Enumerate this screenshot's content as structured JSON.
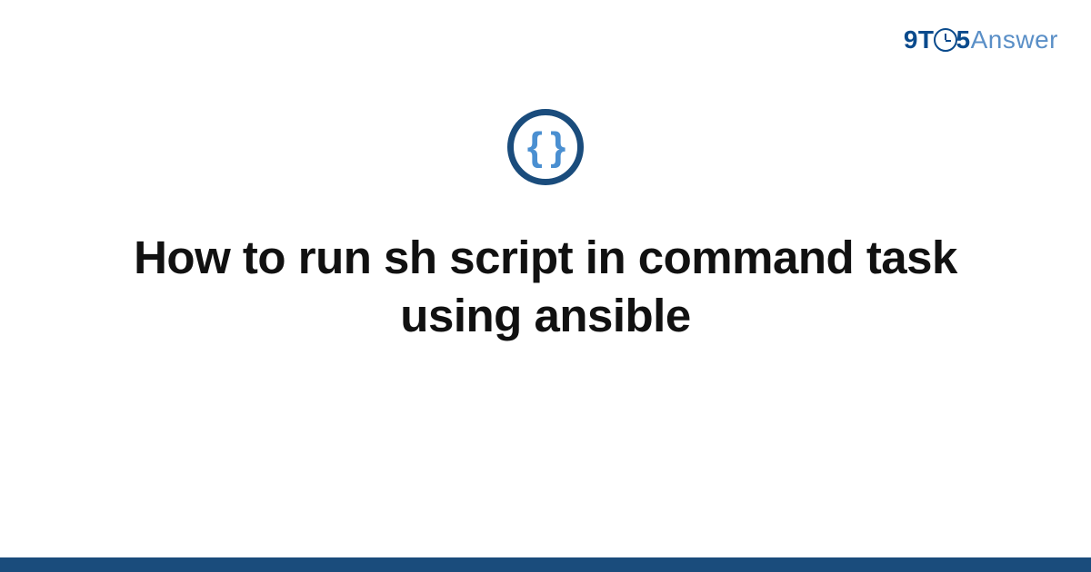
{
  "logo": {
    "part1": "9T",
    "part2": "5",
    "part3": "Answer"
  },
  "icon": {
    "name": "code-braces-icon",
    "glyph": "{ }"
  },
  "title": "How to run sh script in command task using ansible",
  "colors": {
    "primary_dark": "#1a4c7c",
    "primary_light": "#4a8fd1",
    "logo_dark": "#0a4a8c",
    "logo_light": "#5a8fc7"
  }
}
